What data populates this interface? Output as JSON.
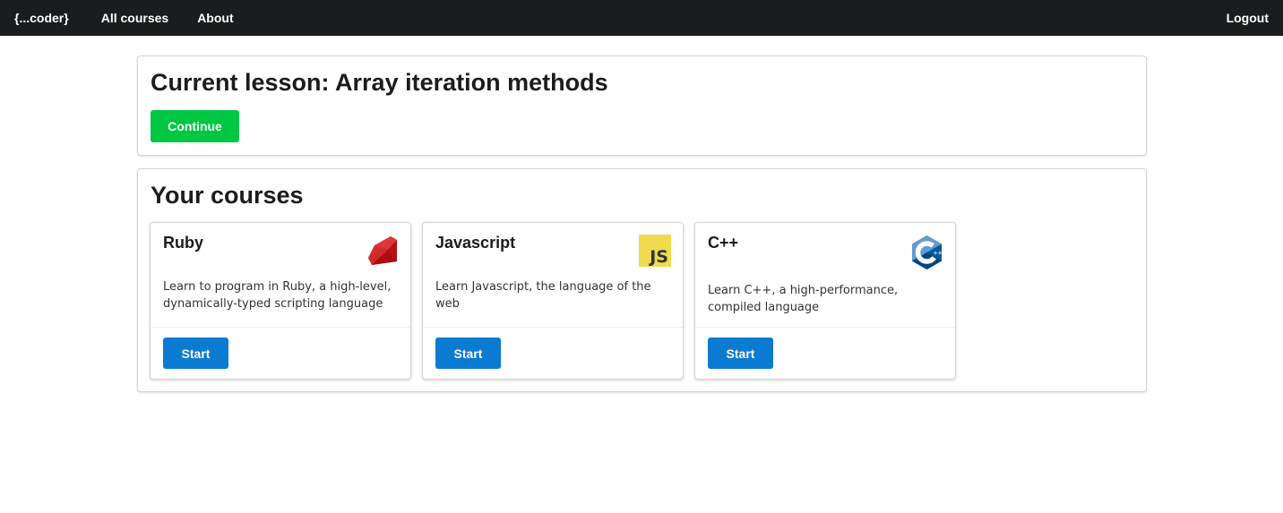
{
  "nav": {
    "brand": "{...coder}",
    "all_courses": "All courses",
    "about": "About",
    "logout": "Logout"
  },
  "current_lesson": {
    "heading": "Current lesson: Array iteration methods",
    "continue_label": "Continue",
    "continue_color": "#00c642"
  },
  "courses": {
    "heading": "Your courses",
    "start_color": "#0a7bd1",
    "items": [
      {
        "title": "Ruby",
        "description": "Learn to program in Ruby, a high-level, dynamically-typed scripting language",
        "icon": "ruby-icon",
        "start_label": "Start"
      },
      {
        "title": "Javascript",
        "description": "Learn Javascript, the language of the web",
        "icon": "javascript-icon",
        "icon_text": "JS",
        "start_label": "Start"
      },
      {
        "title": "C++",
        "description": "Learn C++, a high-performance, compiled language",
        "icon": "cplusplus-icon",
        "start_label": "Start"
      }
    ]
  }
}
